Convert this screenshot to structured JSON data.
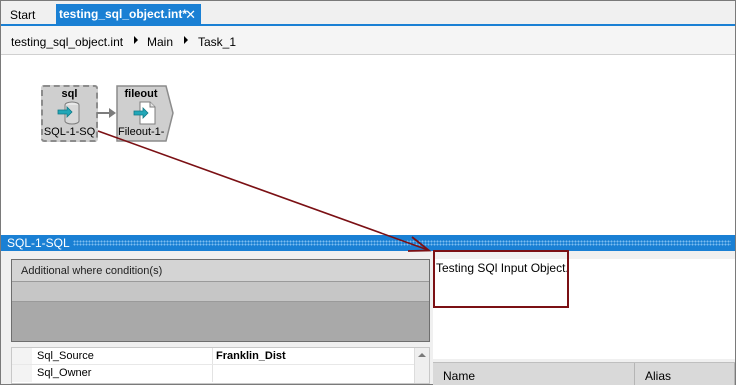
{
  "tabs": [
    {
      "label": "Start"
    },
    {
      "label": "testing_sql_object.int*"
    }
  ],
  "breadcrumb": [
    "testing_sql_object.int",
    "Main",
    "Task_1"
  ],
  "canvas": {
    "nodes": [
      {
        "title": "sql",
        "label": "SQL-1-SQ",
        "icon": "database-icon"
      },
      {
        "title": "fileout",
        "label": "Fileout-1-",
        "icon": "file-icon"
      }
    ]
  },
  "properties": {
    "title": "SQL-1-SQL",
    "where_header": "Additional where condition(s)",
    "grid": [
      {
        "name": "Sql_Source",
        "value": "Franklin_Dist"
      },
      {
        "name": "Sql_Owner",
        "value": ""
      }
    ],
    "description": "Testing SQl Input Object.",
    "columns": [
      "Name",
      "Alias"
    ]
  },
  "colors": {
    "accent": "#1a80d4",
    "annotation": "#7b1014"
  }
}
